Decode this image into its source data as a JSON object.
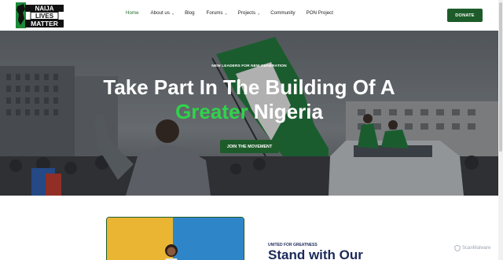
{
  "header": {
    "logo_text": [
      "NAIJA",
      "LIVES",
      "MATTER"
    ],
    "nav": [
      {
        "label": "Home",
        "active": true,
        "dropdown": false
      },
      {
        "label": "About us",
        "active": false,
        "dropdown": true
      },
      {
        "label": "Blog",
        "active": false,
        "dropdown": false
      },
      {
        "label": "Forums",
        "active": false,
        "dropdown": true
      },
      {
        "label": "Projects",
        "active": false,
        "dropdown": true
      },
      {
        "label": "Community",
        "active": false,
        "dropdown": false
      },
      {
        "label": "PON Project",
        "active": false,
        "dropdown": false
      }
    ],
    "donate_label": "DONATE"
  },
  "hero": {
    "eyebrow": "NEW LEADERS FOR NEW GENERATION",
    "heading_line1": "Take Part In The Building Of A",
    "heading_green": "Greater",
    "heading_line2_rest": " Nigeria",
    "cta_label": "JOIN THE MOVEMENT"
  },
  "section": {
    "eyebrow": "UNITED FOR GREATNESS",
    "heading": "Stand with Our"
  },
  "watermark": "ScanMalware",
  "colors": {
    "brand_green": "#1d5c2a",
    "accent_green": "#2fd34b",
    "heading_navy": "#1c2a5a"
  }
}
